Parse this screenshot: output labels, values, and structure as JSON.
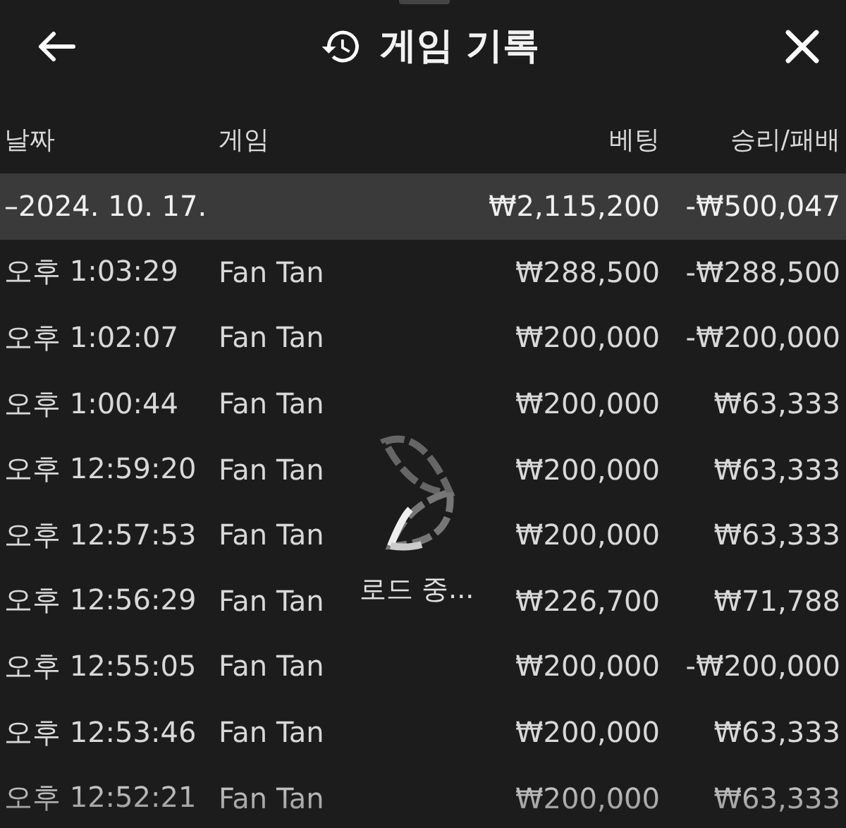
{
  "header": {
    "title": "게임 기록"
  },
  "columns": [
    "날짜",
    "게임",
    "베팅",
    "승리/패배"
  ],
  "date_group": {
    "date": "–2024. 10. 17.",
    "bet": "₩2,115,200",
    "result": "-₩500,047"
  },
  "rows": [
    {
      "time": "오후 1:03:29",
      "game": "Fan Tan",
      "bet": "₩288,500",
      "result": "-₩288,500"
    },
    {
      "time": "오후 1:02:07",
      "game": "Fan Tan",
      "bet": "₩200,000",
      "result": "-₩200,000"
    },
    {
      "time": "오후 1:00:44",
      "game": "Fan Tan",
      "bet": "₩200,000",
      "result": "₩63,333"
    },
    {
      "time": "오후 12:59:20",
      "game": "Fan Tan",
      "bet": "₩200,000",
      "result": "₩63,333"
    },
    {
      "time": "오후 12:57:53",
      "game": "Fan Tan",
      "bet": "₩200,000",
      "result": "₩63,333"
    },
    {
      "time": "오후 12:56:29",
      "game": "Fan Tan",
      "bet": "₩226,700",
      "result": "₩71,788"
    },
    {
      "time": "오후 12:55:05",
      "game": "Fan Tan",
      "bet": "₩200,000",
      "result": "-₩200,000"
    },
    {
      "time": "오후 12:53:46",
      "game": "Fan Tan",
      "bet": "₩200,000",
      "result": "₩63,333"
    },
    {
      "time": "오후 12:52:21",
      "game": "Fan Tan",
      "bet": "₩200,000",
      "result": "₩63,333"
    }
  ],
  "loading": {
    "label": "로드 중..."
  }
}
